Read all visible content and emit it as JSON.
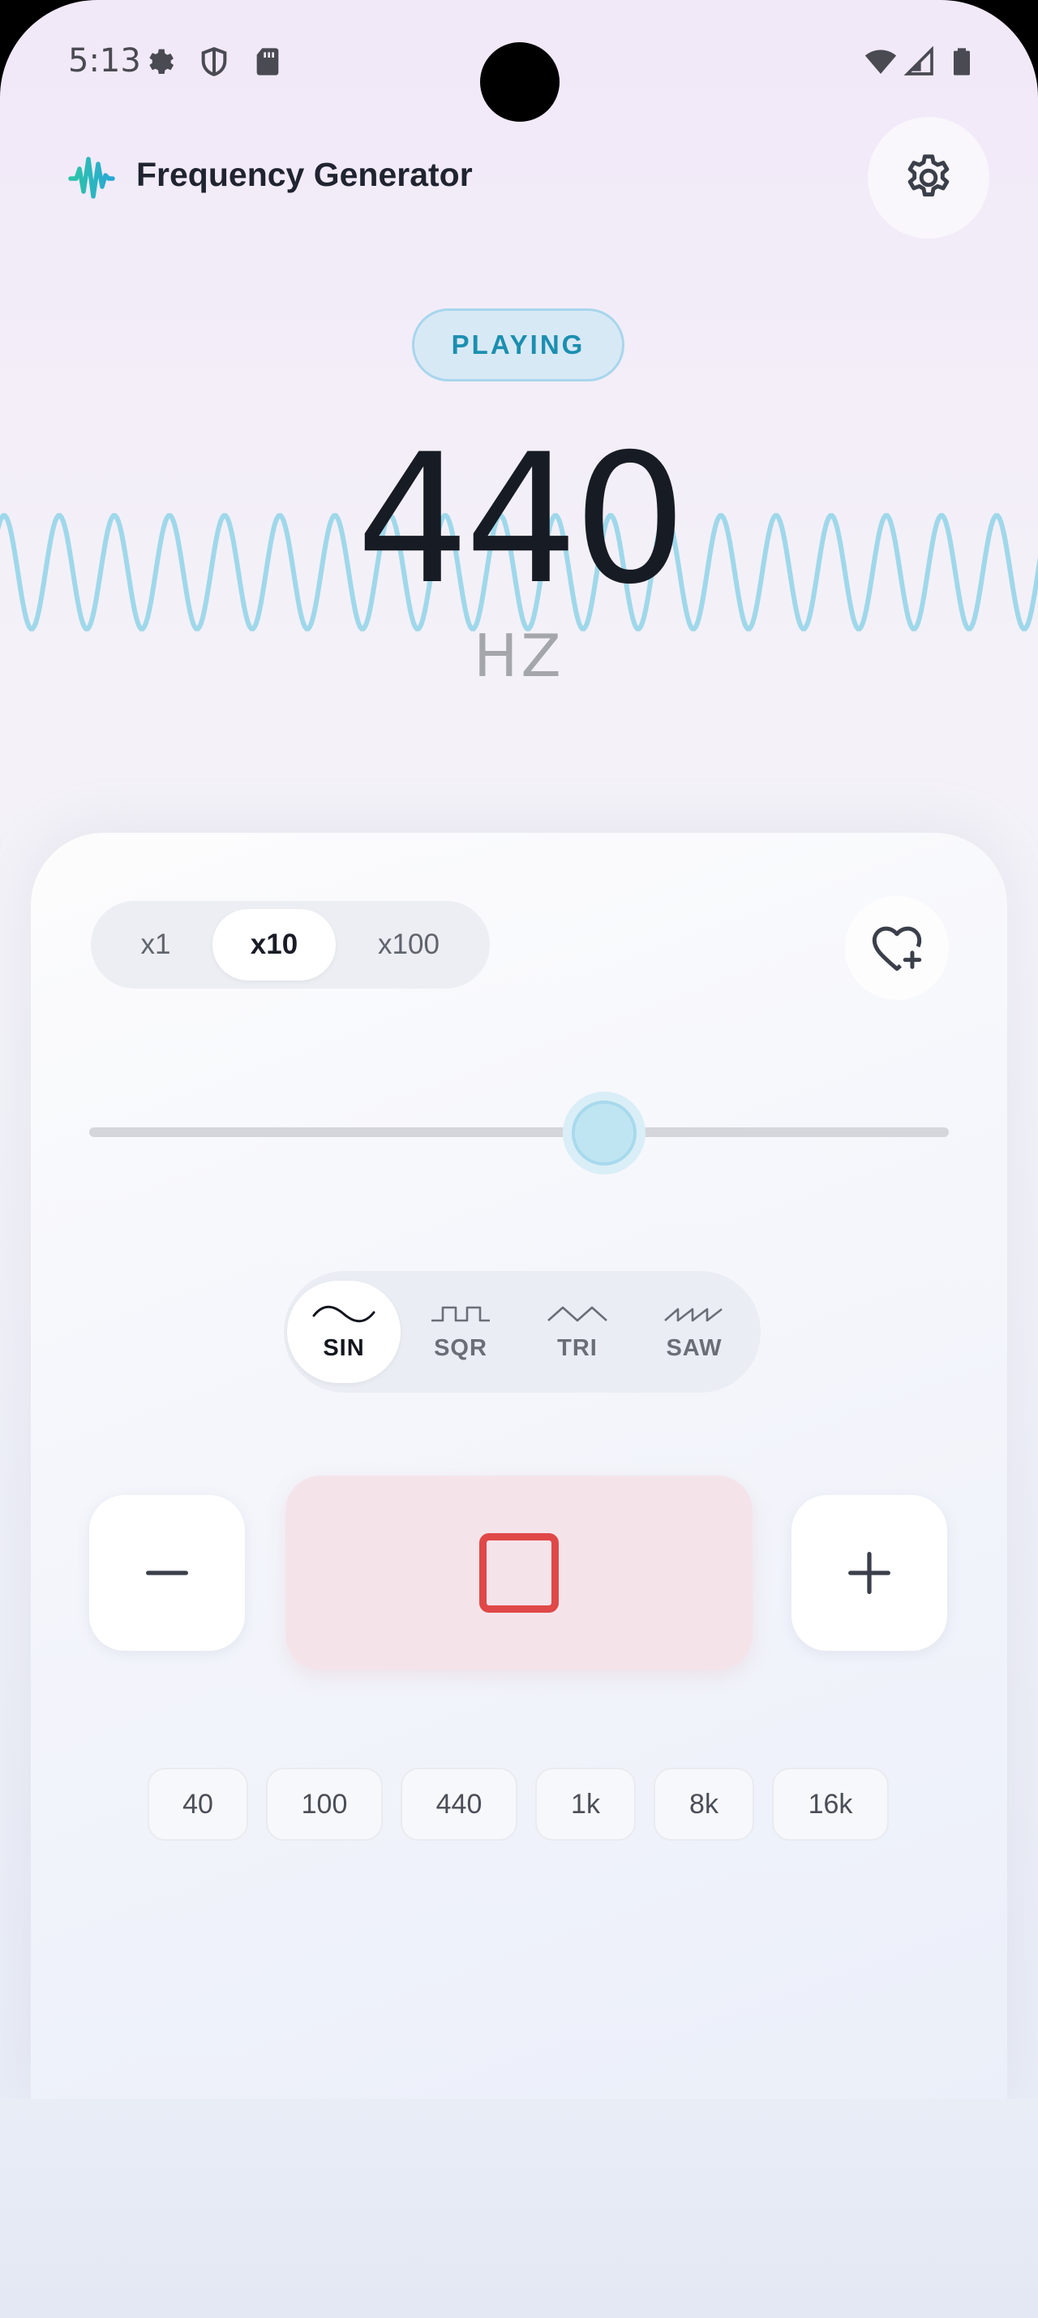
{
  "status_bar": {
    "time": "5:13",
    "left_icons": [
      "gear-icon",
      "shield-icon",
      "sd-card-icon"
    ],
    "right_icons": [
      "wifi-icon",
      "signal-icon",
      "battery-icon"
    ]
  },
  "header": {
    "title": "Frequency Generator",
    "logo_icon": "waveform-icon",
    "settings_icon": "gear-icon"
  },
  "player": {
    "status": "PLAYING",
    "frequency": "440",
    "unit": "HZ",
    "wave_color": "#9fd8ea"
  },
  "multiplier": {
    "options": [
      {
        "label": "x1",
        "active": false
      },
      {
        "label": "x10",
        "active": true
      },
      {
        "label": "x100",
        "active": false
      }
    ]
  },
  "favorite_icon": "heart-plus-icon",
  "slider": {
    "value_fraction": 0.56
  },
  "waveforms": [
    {
      "label": "SIN",
      "icon": "sine-wave-icon",
      "active": true
    },
    {
      "label": "SQR",
      "icon": "square-wave-icon",
      "active": false
    },
    {
      "label": "TRI",
      "icon": "triangle-wave-icon",
      "active": false
    },
    {
      "label": "SAW",
      "icon": "sawtooth-wave-icon",
      "active": false
    }
  ],
  "controls": {
    "decrement_icon": "minus-icon",
    "stop_icon": "stop-icon",
    "increment_icon": "plus-icon",
    "stop_color": "#e04848"
  },
  "presets": [
    "40",
    "100",
    "440",
    "1k",
    "8k",
    "16k"
  ],
  "colors": {
    "accent": "#1b8fb0",
    "logo_gradient_start": "#2cc6a6",
    "logo_gradient_end": "#2aa7d6"
  }
}
